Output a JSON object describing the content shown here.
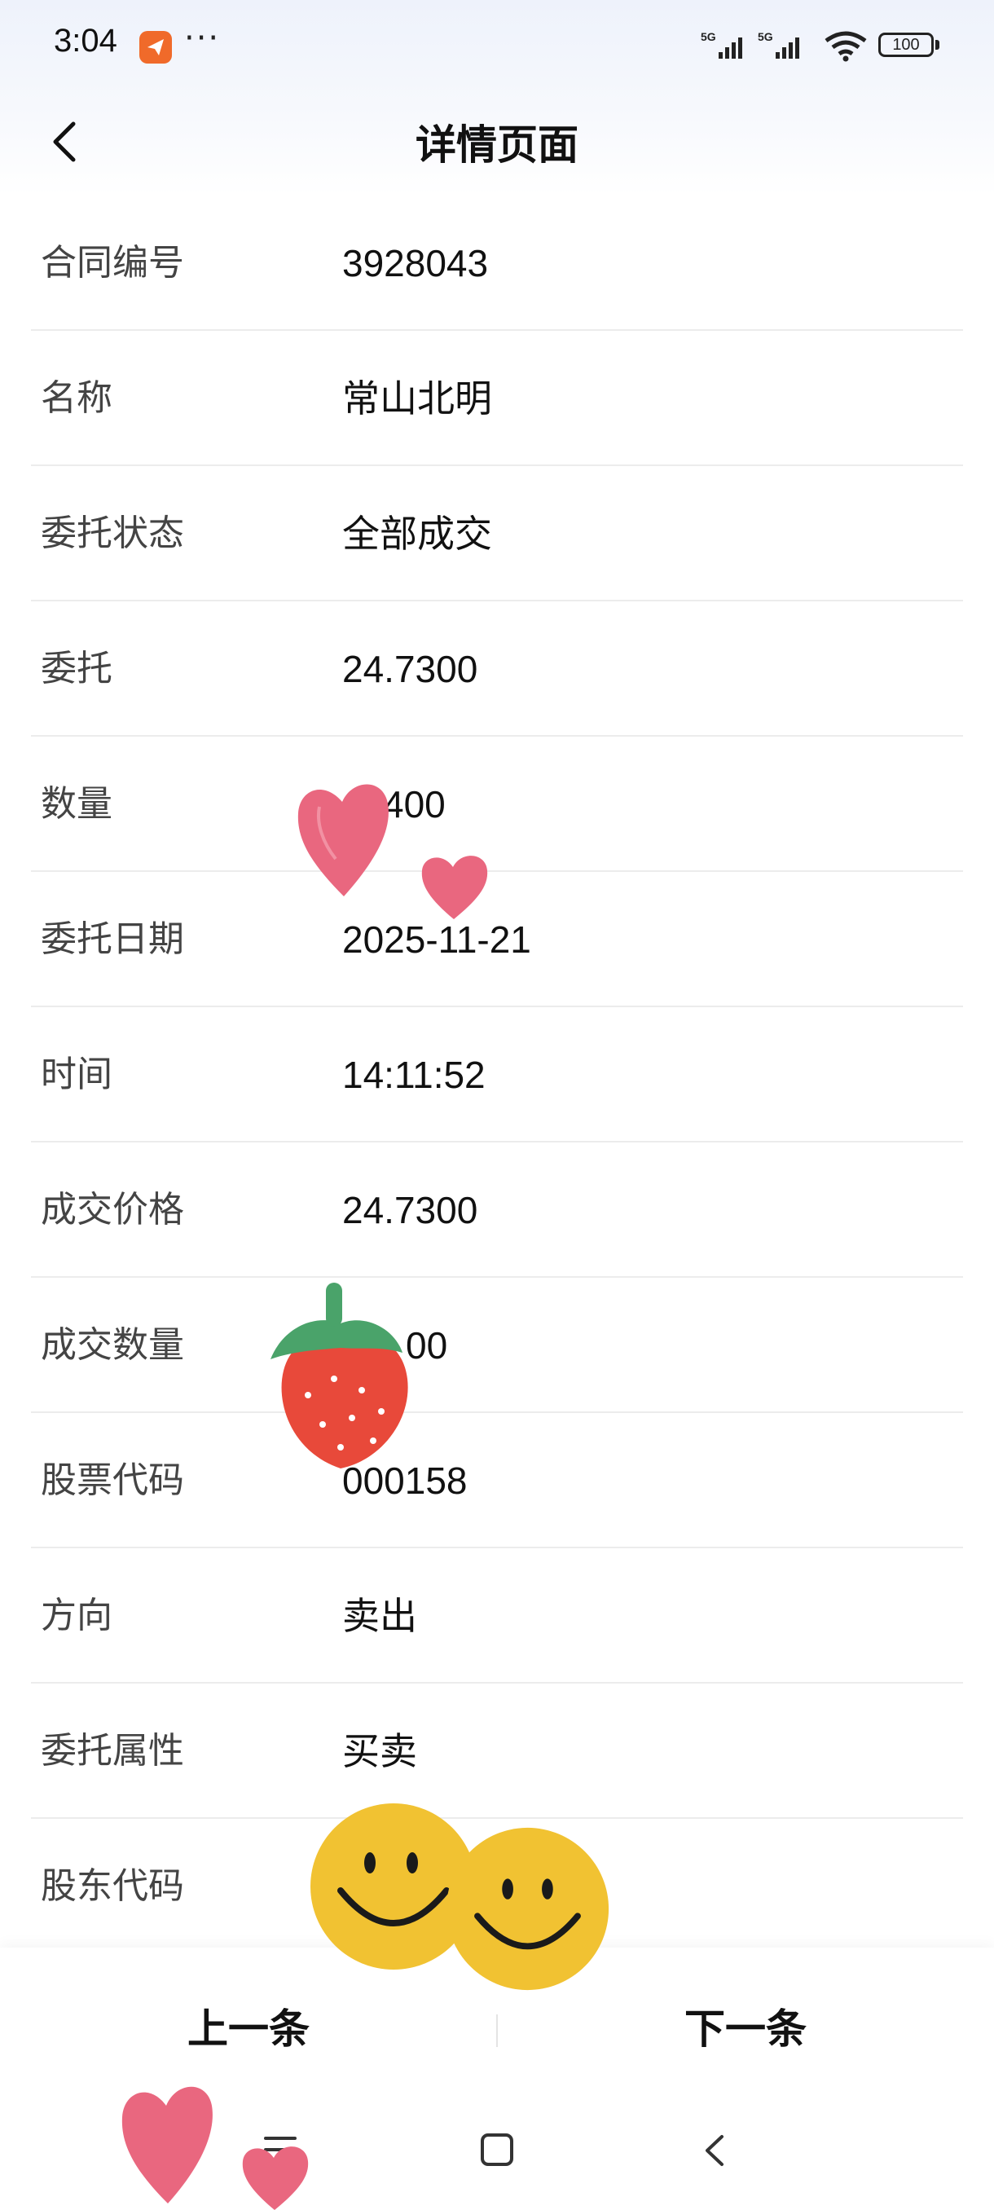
{
  "status_bar": {
    "time": "3:04",
    "dots": "···",
    "battery": "100",
    "network1": "5G",
    "network2": "5G"
  },
  "header": {
    "title": "详情页面"
  },
  "rows": [
    {
      "label": "合同编号",
      "value": "3928043"
    },
    {
      "label": "名称",
      "value": "常山北明"
    },
    {
      "label": "委托状态",
      "value": "全部成交"
    },
    {
      "label": "委托",
      "value": "24.7300"
    },
    {
      "label": "数量",
      "value": "400"
    },
    {
      "label": "委托日期",
      "value": "2025-11-21"
    },
    {
      "label": "时间",
      "value": "14:11:52"
    },
    {
      "label": "成交价格",
      "value": "24.7300"
    },
    {
      "label": "成交数量",
      "value": "00"
    },
    {
      "label": "股票代码",
      "value": "000158"
    },
    {
      "label": "方向",
      "value": "卖出"
    },
    {
      "label": "委托属性",
      "value": "买卖"
    },
    {
      "label": "股东代码",
      "value": ""
    }
  ],
  "bottom_bar": {
    "prev_label": "上一条",
    "next_label": "下一条"
  },
  "icons": {
    "back": "chevron-left-icon",
    "menu": "menu-icon",
    "home": "home-square-icon",
    "nav_back": "nav-back-icon"
  },
  "colors": {
    "accent_orange": "#f06a2a",
    "heart_pink": "#e9677f",
    "smiley_yellow": "#f1c232",
    "strawberry_red": "#e8493a",
    "leaf_green": "#4aa36a"
  }
}
